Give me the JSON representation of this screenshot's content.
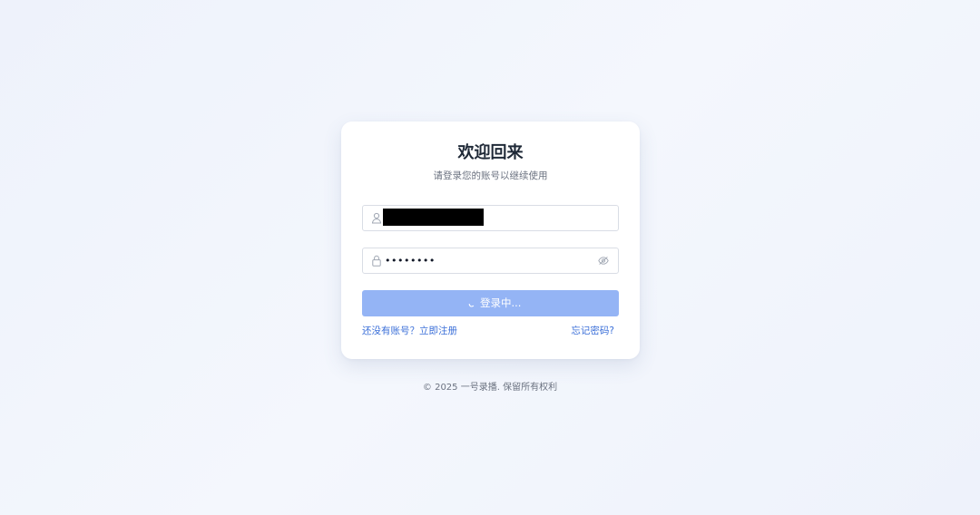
{
  "login": {
    "title": "欢迎回来",
    "subtitle": "请登录您的账号以继续使用",
    "username": {
      "value": "",
      "icon": "user-icon"
    },
    "password": {
      "value": "••••••••",
      "icon": "lock-icon",
      "toggle_icon": "eye-icon"
    },
    "submit_label": "登录中...",
    "submit_state": "loading",
    "register_link": "还没有账号？立即注册",
    "forgot_link": "忘记密码?"
  },
  "footer": {
    "copyright": "© 2025 一号录播. 保留所有权利"
  },
  "colors": {
    "page_background": "#f0f4fc",
    "button_loading": "#94b4f5",
    "link": "#3b6fd8",
    "title": "#1f2937"
  }
}
